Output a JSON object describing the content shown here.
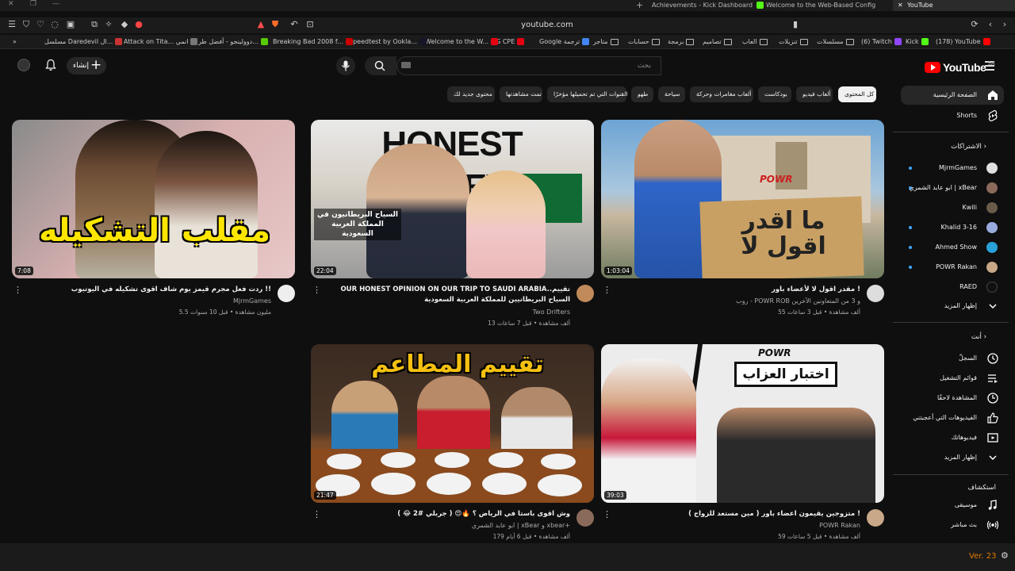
{
  "browser": {
    "tabs": [
      {
        "label": "Achievements - Kick Dashboard",
        "color": "#53fc18"
      },
      {
        "label": "Welcome to the Web-Based Config",
        "color": "#888888"
      },
      {
        "label": "YouTube",
        "color": "#ff0000"
      }
    ],
    "url": "youtube.com",
    "bookmarks": [
      {
        "label": "(178) YouTube",
        "icon": "youtube"
      },
      {
        "label": "Kick",
        "icon": "kick"
      },
      {
        "label": "(6) Twitch",
        "icon": "twitch"
      },
      {
        "label": "مسلسلات",
        "icon": "folder"
      },
      {
        "label": "تنزيلات",
        "icon": "folder"
      },
      {
        "label": "العاب",
        "icon": "folder"
      },
      {
        "label": "تصاميم",
        "icon": "folder"
      },
      {
        "label": "برمجة",
        "icon": "folder"
      },
      {
        "label": "حسابات",
        "icon": "folder"
      },
      {
        "label": "متاجر",
        "icon": "folder"
      },
      {
        "label": "Google ترجمة",
        "icon": "translate"
      },
      {
        "label": "5G CPE",
        "icon": "huawei"
      },
      {
        "label": "Welcome to the W...",
        "icon": "web"
      },
      {
        "label": "Speedtest by Ookla...",
        "icon": "speedtest"
      },
      {
        "label": "Breaking Bad 2008 f...",
        "icon": "bb"
      },
      {
        "label": "دوولينجو - أفضل طر...",
        "icon": "duolingo"
      },
      {
        "label": "Attack on Tita... انمي",
        "icon": "aot"
      },
      {
        "label": "مسلسل Daredevil ال...",
        "icon": "daredevil"
      }
    ]
  },
  "header": {
    "search_placeholder": "بحث",
    "create_label": "إنشاء",
    "logo_text": "YouTube",
    "logo_region": "SA"
  },
  "chips": [
    {
      "label": "كل المحتوى",
      "active": true
    },
    {
      "label": "ألعاب فيديو",
      "active": false
    },
    {
      "label": "بودكاست",
      "active": false
    },
    {
      "label": "ألعاب مغامرات وحركة",
      "active": false
    },
    {
      "label": "سياحة",
      "active": false
    },
    {
      "label": "طهو",
      "active": false
    },
    {
      "label": "القنوات التي تم تحميلها مؤخرًا",
      "active": false
    },
    {
      "label": "تمت مشاهدتها",
      "active": false
    },
    {
      "label": "محتوى جديد لك",
      "active": false
    }
  ],
  "sidebar": {
    "home": "الصفحة الرئيسية",
    "shorts": "Shorts",
    "subscriptions_title": "الاشتراكات",
    "subscriptions": [
      {
        "name": "MjrmGames",
        "color": "#e0e0e0"
      },
      {
        "name": "ابو عابد الشمري | xBear",
        "color": "#8a6a5a"
      },
      {
        "name": "Kwili",
        "color": "#6a5a4a"
      },
      {
        "name": "Khalid 3-16",
        "color": "#9ad"
      },
      {
        "name": "Ahmed Show",
        "color": "#2aa0d8"
      },
      {
        "name": "POWR Rakan",
        "color": "#c8a888"
      },
      {
        "name": "RAED",
        "color": "#111111"
      }
    ],
    "show_more": "إظهار المزيد",
    "you_title": "أنت",
    "you_items": [
      {
        "label": "السجلّ",
        "icon": "history-icon"
      },
      {
        "label": "قوائم التشغيل",
        "icon": "playlist-icon"
      },
      {
        "label": "المشاهدة لاحقًا",
        "icon": "watch-later-icon"
      },
      {
        "label": "الفيديوهات التي أعجبتني",
        "icon": "like-icon"
      },
      {
        "label": "فيديوهاتك",
        "icon": "your-videos-icon"
      }
    ],
    "you_show_more": "إظهار المزيد",
    "explore_title": "استكشاف",
    "explore_items": [
      {
        "label": "موسيقى",
        "icon": "music-icon"
      },
      {
        "label": "بث مباشر",
        "icon": "live-icon"
      }
    ]
  },
  "videos": [
    {
      "title": "مقدر اقول لا لأعضاء باور !",
      "channel": "روب - POWR ROB و 3 من المتعاونين الآخرين",
      "meta": "55 ألف مشاهدة • قبل 3 ساعات",
      "duration": "1:03:04",
      "thumb_text": "ما اقدر اقول لا",
      "thumb_brand": "POWR"
    },
    {
      "title": "OUR HONEST OPINION ON OUR TRIP TO SAUDI ARABIA..تقييم السياح البريطانيين للمملكة العربية السعودية",
      "channel": "Two Drifters",
      "meta": "13 ألف مشاهدة • قبل 7 ساعات",
      "duration": "22:04",
      "thumb_text": "HONEST REVIEW",
      "thumb_caption": "السياح البريطانيون في المملكة العربية السعودية"
    },
    {
      "title": "ردت فعل مجرم قيمز يوم شاف اقوى تشكيله في اليوتيوب !!",
      "channel": "MjrmGames",
      "meta": "5.5 مليون مشاهدة • قبل 10 سنوات",
      "duration": "7:08",
      "thumb_text": "مقلب التشكيله"
    },
    {
      "title": "متزوجين يقيمون اعضاء باور ( مين مستعد للزواج ) !",
      "channel": "POWR Rakan",
      "meta": "59 ألف مشاهدة • قبل 5 ساعات",
      "duration": "39:03",
      "thumb_text": "اختبار العزاب",
      "thumb_brand": "POWR"
    },
    {
      "title": "وش اقوى باستا في الرياض ؟ 🔥😍 ( جربلي #2 😂 )",
      "channel": "ابو عابد الشمري | xBear و xbear+",
      "meta": "179 ألف مشاهدة • قبل 6 أيام",
      "duration": "21:47",
      "thumb_text": "تقييم المطاعم"
    }
  ],
  "version_text": "Ver. 23"
}
